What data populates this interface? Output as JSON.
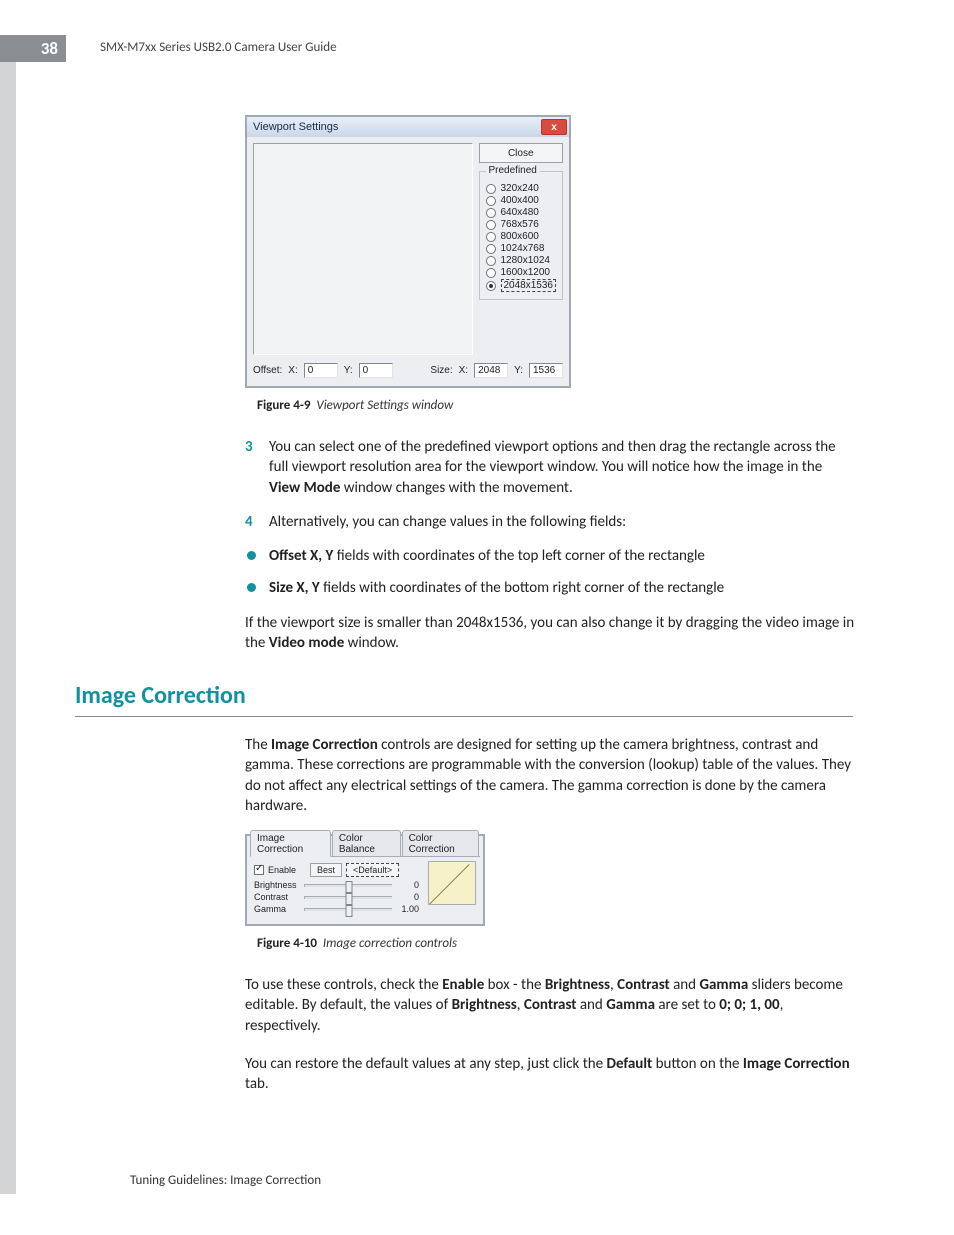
{
  "page_number": "38",
  "running_head": "SMX-M7xx Series USB2.0 Camera User Guide",
  "footer": "Tuning Guidelines:  Image Correction",
  "section_heading": "Image Correction",
  "figure1": {
    "caption_label": "Figure 4-9",
    "caption_text": "Viewport Settings window",
    "window_title": "Viewport Settings",
    "close_button": "Close",
    "close_x": "x",
    "predefined_label": "Predefined",
    "predefined_options": [
      "320x240",
      "400x400",
      "640x480",
      "768x576",
      "800x600",
      "1024x768",
      "1280x1024",
      "1600x1200",
      "2048x1536"
    ],
    "predefined_selected": "2048x1536",
    "offset_label": "Offset:",
    "offset_x_label": "X:",
    "offset_y_label": "Y:",
    "offset_x_value": "0",
    "offset_y_value": "0",
    "size_label": "Size:",
    "size_x_label": "X:",
    "size_y_label": "Y:",
    "size_x_value": "2048",
    "size_y_value": "1536"
  },
  "step3_num": "3",
  "step3_text_a": "You can select one of the predefined viewport options and then drag the rectangle across the full viewport resolution area for the viewport window. You will notice how the image in the ",
  "step3_bold": "View Mode",
  "step3_text_b": " window changes with the movement.",
  "step4_num": "4",
  "step4_text": "Alternatively, you can change values in the following fields:",
  "bullet1_bold": "Offset X, Y",
  "bullet1_rest": " fields with coordinates of the top left corner of the rectangle",
  "bullet2_bold": "Size X, Y",
  "bullet2_rest": " fields with coordinates of the bottom right corner of the rectangle",
  "para1_a": "If the viewport size is smaller than 2048x1536, you can also change it by dragging the video image in the ",
  "para1_bold": "Video mode",
  "para1_b": " window.",
  "ic_para1_a": "The ",
  "ic_para1_bold": "Image Correction",
  "ic_para1_b": " controls are designed for setting up the camera brightness, contrast and gamma. These corrections are programmable with the conversion (lookup) table of the values. They do not affect any electrical settings of the camera. The gamma correction is done by the camera hardware.",
  "figure2": {
    "caption_label": "Figure 4-10",
    "caption_text": "Image correction controls",
    "tabs": [
      "Image Correction",
      "Color Balance",
      "Color Correction"
    ],
    "active_tab": "Image Correction",
    "enable_label": "Enable",
    "best_button": "Best",
    "default_button": "<Default>",
    "brightness_label": "Brightness",
    "brightness_value": "0",
    "contrast_label": "Contrast",
    "contrast_value": "0",
    "gamma_label": "Gamma",
    "gamma_value": "1.00"
  },
  "ic_para2_a": "To use these controls, check the ",
  "ic_para2_b1": "Enable",
  "ic_para2_c": " box - the ",
  "ic_para2_b2": "Brightness",
  "ic_para2_d": ", ",
  "ic_para2_b3": "Contrast",
  "ic_para2_e": " and ",
  "ic_para2_b4": "Gamma",
  "ic_para2_f": " sliders become editable. By default, the values of ",
  "ic_para2_b5": "Brightness",
  "ic_para2_g": ", ",
  "ic_para2_b6": "Contrast",
  "ic_para2_h": " and ",
  "ic_para2_b7": "Gamma",
  "ic_para2_i": " are set to ",
  "ic_para2_b8": "0; 0; 1, 00",
  "ic_para2_j": ", respectively.",
  "ic_para3_a": "You can restore the default values at any step, just click the ",
  "ic_para3_b1": "Default",
  "ic_para3_b": " button on the ",
  "ic_para3_b2": "Image Correction",
  "ic_para3_c": " tab."
}
